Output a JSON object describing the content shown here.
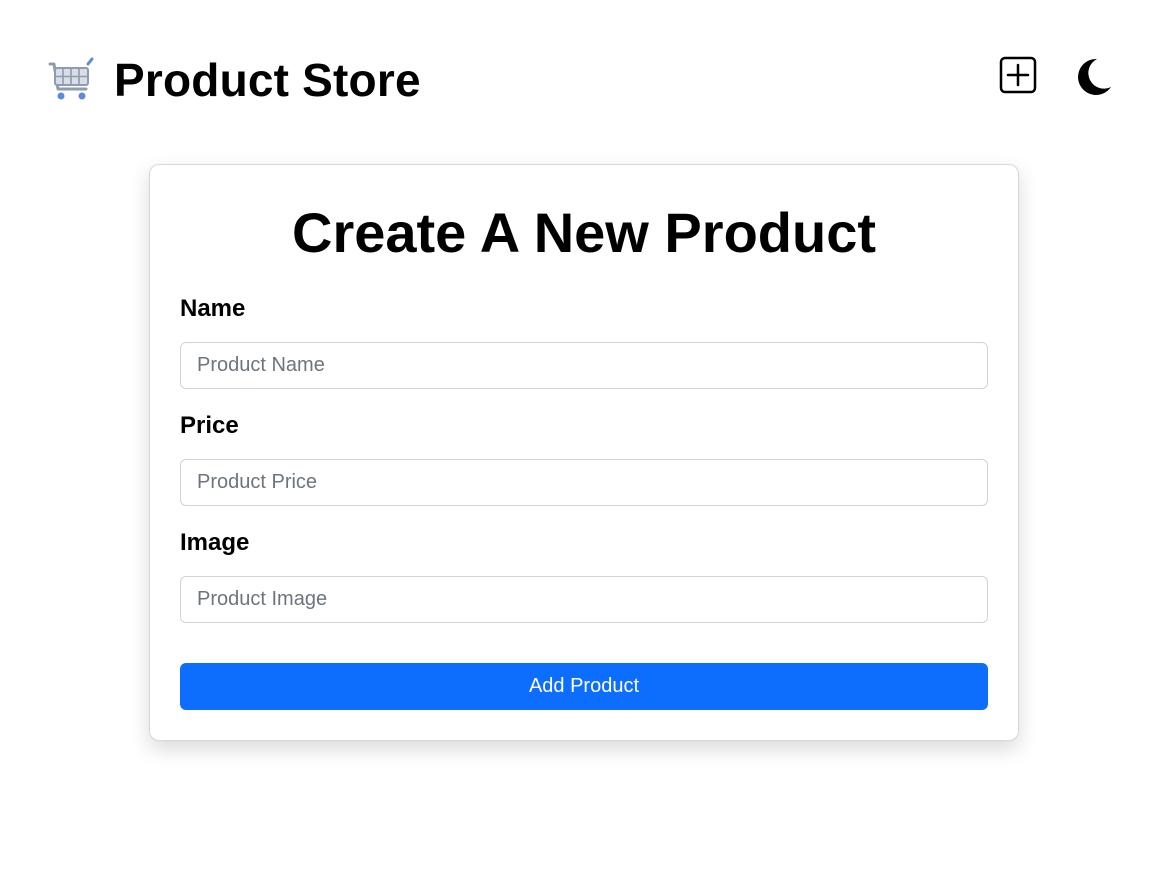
{
  "header": {
    "title": "Product Store",
    "logo_icon": "shopping-cart-icon",
    "create_icon": "plus-square-icon",
    "theme_icon": "moon-icon"
  },
  "form": {
    "title": "Create A New Product",
    "fields": [
      {
        "label": "Name",
        "placeholder": "Product Name",
        "value": ""
      },
      {
        "label": "Price",
        "placeholder": "Product Price",
        "value": ""
      },
      {
        "label": "Image",
        "placeholder": "Product Image",
        "value": ""
      }
    ],
    "submit_label": "Add Product"
  },
  "colors": {
    "accent": "#0d6efd",
    "text": "#000000",
    "placeholder": "#6c757d",
    "border": "#cfd4da"
  }
}
